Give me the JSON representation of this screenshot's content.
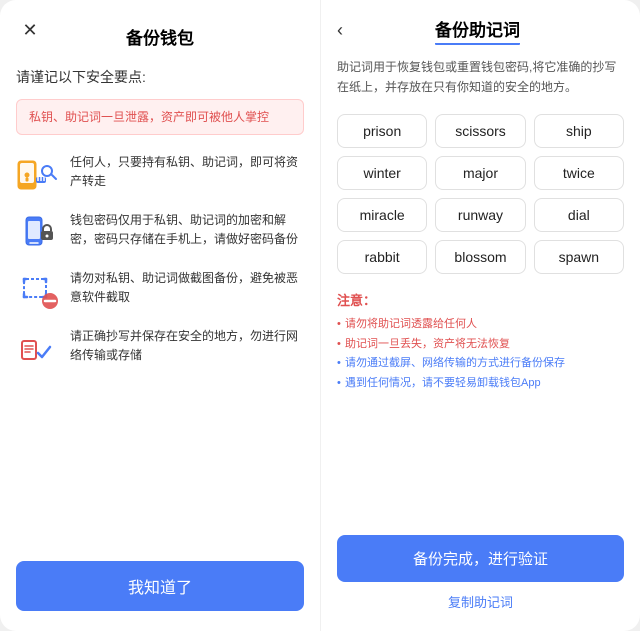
{
  "left": {
    "title": "备份钱包",
    "subtitle": "请谨记以下安全要点:",
    "warning": "私钥、助记词一旦泄露，资产即可被他人掌控",
    "security_items": [
      {
        "icon": "key-phone-icon",
        "text": "任何人，只要持有私钥、助记词，即可将资产转走"
      },
      {
        "icon": "phone-lock-icon",
        "text": "钱包密码仅用于私钥、助记词的加密和解密，密码只存储在手机上，请做好密码备份"
      },
      {
        "icon": "screenshot-ban-icon",
        "text": "请勿对私钥、助记词做截图备份，避免被恶意软件截取"
      },
      {
        "icon": "safe-copy-icon",
        "text": "请正确抄写并保存在安全的地方，勿进行网络传输或存储"
      }
    ],
    "button_label": "我知道了"
  },
  "right": {
    "title": "备份助记词",
    "back_icon": "‹",
    "description": "助记词用于恢复钱包或重置钱包密码,将它准确的抄写在纸上，并存放在只有你知道的安全的地方。",
    "mnemonic_words": [
      "prison",
      "scissors",
      "ship",
      "winter",
      "major",
      "twice",
      "miracle",
      "runway",
      "dial",
      "rabbit",
      "blossom",
      "spawn"
    ],
    "notes_title": "注意：",
    "notes": [
      {
        "text": "请勿将助记词透露给任何人",
        "highlight": false
      },
      {
        "text": "助记词一旦丢失，资产将无法恢复",
        "highlight": false
      },
      {
        "text": "请勿通过截屏、网络传输的方式进行备份保存",
        "highlight": true
      },
      {
        "text": "遇到任何情况，请不要轻易卸载钱包App",
        "highlight": true
      }
    ],
    "verify_button": "备份完成，进行验证",
    "copy_link": "复制助记词"
  }
}
